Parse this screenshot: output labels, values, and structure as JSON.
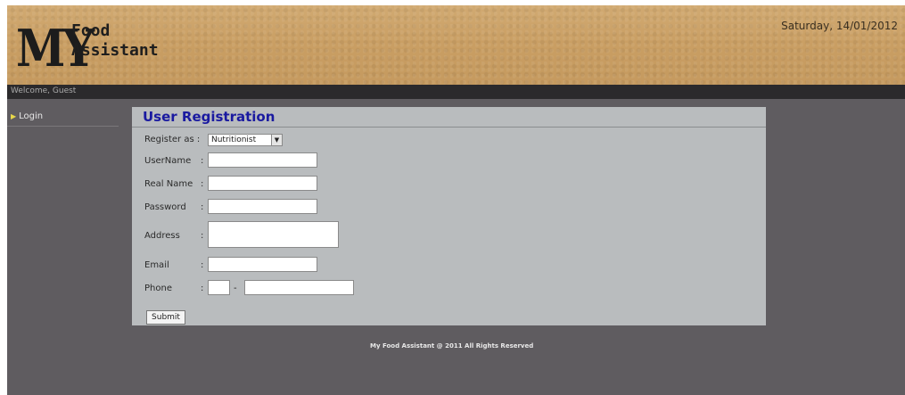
{
  "header": {
    "logo_my": "MY",
    "logo_food": "Food",
    "logo_assistant": "Assistant",
    "date": "Saturday, 14/01/2012"
  },
  "welcome": "Welcome, Guest",
  "sidebar": {
    "items": [
      {
        "label": "Login"
      }
    ]
  },
  "form": {
    "title": "User Registration",
    "register_as_label": "Register as :",
    "register_as_value": "Nutritionist",
    "username_label": "UserName",
    "realname_label": "Real Name",
    "password_label": "Password",
    "address_label": "Address",
    "email_label": "Email",
    "phone_label": "Phone",
    "colon": ":",
    "dash": "-",
    "submit_label": "Submit"
  },
  "footer": "My Food Assistant @ 2011 All Rights Reserved",
  "colors": {
    "header_bg": "#c99e63",
    "page_bg": "#5f5c60",
    "panel_bg": "#b9bcbe",
    "title_color": "#1a1aa0"
  }
}
